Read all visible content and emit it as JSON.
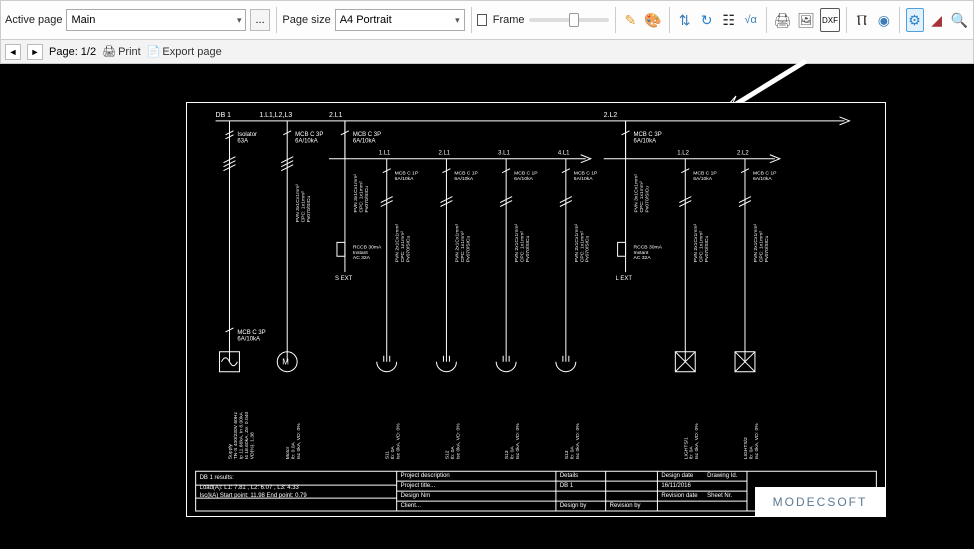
{
  "toolbar": {
    "activePageLabel": "Active page",
    "activePageValue": "Main",
    "activePageMore": "...",
    "pageSizeLabel": "Page size",
    "pageSizeValue": "A4 Portrait",
    "frameLabel": "Frame"
  },
  "toolbar2": {
    "pageInfo": "Page: 1/2",
    "printLabel": "Print",
    "exportLabel": "Export page"
  },
  "diagram": {
    "dbLabel": "DB 1",
    "bus1": "1.L1,L2,L3",
    "bus2": "2.L1",
    "bus3": "2.L2",
    "isolator": "Isolator\n63A",
    "mcb3p": "MCB C 3P\n6A/10kA",
    "supplyCable": "PVN 4x1Cx1mm²\nCPC: 1x1mm²\nPv070/SICu",
    "branchCable3": "PVN 3x1Cx1mm²\nCPC: 1x1mm²\nPv070/SICu",
    "branchCable2": "PVN 2x1Cx1mm²\nCPC: 1x1mm²\nPv070/SICu",
    "mcb1p": "MCB C 1P\n6A/10kA",
    "rccb": "RCCB 30mA\nInstant\nAC 32A",
    "sext": "S EXT",
    "lext": "L EXT",
    "mcbSupply": "MCB C 3P\n6A/10kA",
    "branchHead": [
      "1.L1",
      "2.L1",
      "3.L1",
      "4.L1",
      "1.L2",
      "2.L2"
    ],
    "bottom": {
      "supply": "Supply\nTN-S 400/230V 60Hz\nIp 11.66kA, In 6.00kA\nI4 18.60kA, Ze: 0.040\nVD(%): 1.38",
      "motor": "Motor\nIb: 0.0A\nIsc 0kA, VD: 0%",
      "s11": "S11\nIb: 0A\nIsc 0kA, VD: 0%",
      "s12": "S12\nIb: 0A\nIsc 0kA, VD: 0%",
      "s13": "S13\nIb: 0A\nIsc 0kA, VD: 0%",
      "s14": "S13\nIb: 0A\nIsc 0kA, VD: 0%",
      "l1": "LIGHTS/1\nIb: 0A\nIsc 0kA, VD: 0%",
      "l2": "LIGHTS/2\nIb: 0A\nIsc 0kA, VD: 0%"
    },
    "resultsTitle": "DB 1 results:",
    "resultsLine1": "Load(A): L1: 7.81 , L2: 6.07 , L3: 4.33",
    "resultsLine2": "Isc(kA) Start point: 11.98 End point: 0.79",
    "titleBlock": {
      "projDescLabel": "Project description",
      "projTitle": "Project title...",
      "designNr": "Design Nm",
      "designBy": "Design by",
      "client": "Client...",
      "detailsLabel": "Details",
      "db": "DB 1",
      "revBy": "Revision by",
      "designDate": "Design date",
      "dateVal": "16/11/2016",
      "revDate": "Revision date",
      "drawingId": "Drawing Id.",
      "sheetNr": "Sheet Nr."
    },
    "logo": "MODECSOFT"
  }
}
